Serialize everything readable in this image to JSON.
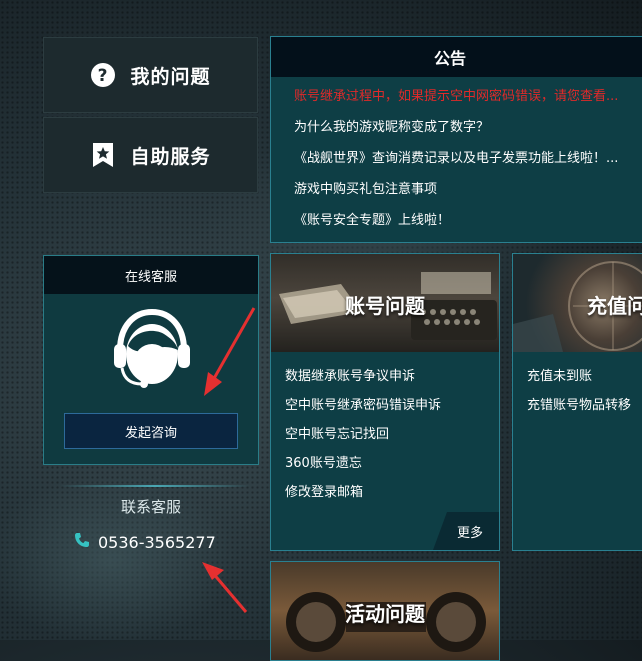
{
  "nav": {
    "my_questions": "我的问题",
    "self_service": "自助服务"
  },
  "online_service": {
    "title": "在线客服",
    "consult_button": "发起咨询"
  },
  "contact": {
    "title": "联系客服",
    "phone": "0536-3565277"
  },
  "notice": {
    "title": "公告",
    "items": [
      "账号继承过程中，如果提示空中网密码错误，请您查看...",
      "为什么我的游戏昵称变成了数字？",
      "《战舰世界》查询消费记录以及电子发票功能上线啦！...",
      "游戏中购买礼包注意事项",
      "《账号安全专题》上线啦！"
    ]
  },
  "cards": {
    "account": {
      "title": "账号问题",
      "links": [
        "数据继承账号争议申诉",
        "空中账号继承密码错误申诉",
        "空中账号忘记找回",
        "360账号遗忘",
        "修改登录邮箱"
      ],
      "more": "更多"
    },
    "recharge": {
      "title": "充值问",
      "links": [
        "充值未到账",
        "充错账号物品转移"
      ]
    },
    "activity": {
      "title": "活动问题"
    }
  },
  "colors": {
    "accent_teal": "#2a8090",
    "panel_bg": "#0e3e45",
    "alert_red": "#e02a2a"
  }
}
